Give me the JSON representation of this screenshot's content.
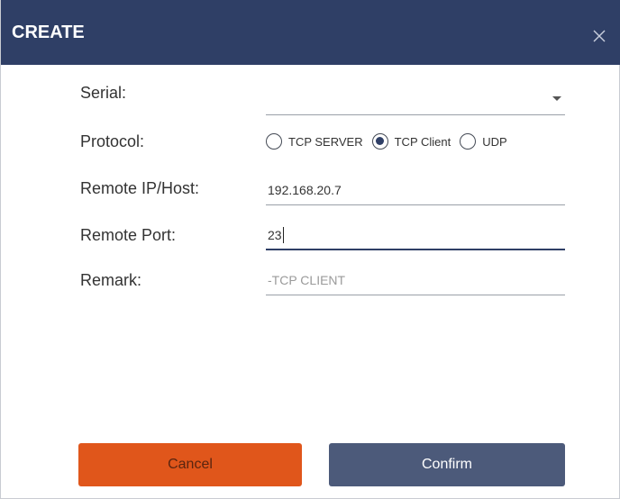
{
  "dialog": {
    "title": "CREATE",
    "close_icon": "close-icon"
  },
  "form": {
    "serial": {
      "label": "Serial:",
      "value": ""
    },
    "protocol": {
      "label": "Protocol:",
      "options": [
        "TCP SERVER",
        "TCP Client",
        "UDP"
      ],
      "selected": "TCP Client"
    },
    "remote_host": {
      "label": "Remote IP/Host:",
      "value": "192.168.20.7"
    },
    "remote_port": {
      "label": "Remote Port:",
      "value": "23"
    },
    "remark": {
      "label": "Remark:",
      "placeholder": "-TCP CLIENT"
    }
  },
  "buttons": {
    "cancel": "Cancel",
    "confirm": "Confirm"
  },
  "colors": {
    "titlebar": "#2f3f66",
    "cancel": "#e0561b",
    "confirm": "#4c5a7a"
  }
}
